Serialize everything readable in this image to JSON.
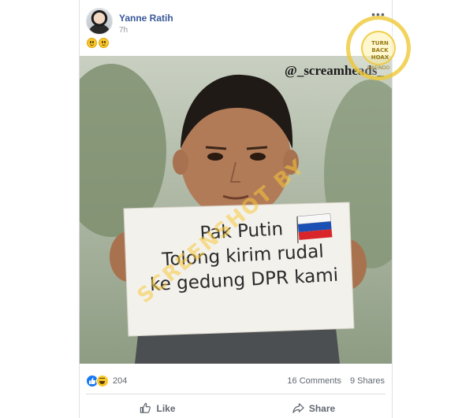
{
  "post": {
    "author": "Yanne Ratih",
    "time": "7h",
    "text_icons": [
      "hugging-face-emoji",
      "grinning-face-emoji"
    ]
  },
  "image": {
    "handle": "@_screamheads_",
    "sign": {
      "line1": "Pak Putin",
      "line2": "Tolong kirim rudal",
      "line3": "ke gedung DPR kami"
    },
    "watermark": "SCREENSHOT BY",
    "badge": {
      "top": "TURN BACK HOAX",
      "bottom": "MAFINDO"
    }
  },
  "footer": {
    "reaction_count": "204",
    "comments": "16 Comments",
    "shares": "9 Shares",
    "like_label": "Like",
    "share_label": "Share"
  },
  "colors": {
    "name_link": "#385898",
    "like_blue": "#1877f2",
    "muted": "#606770"
  }
}
